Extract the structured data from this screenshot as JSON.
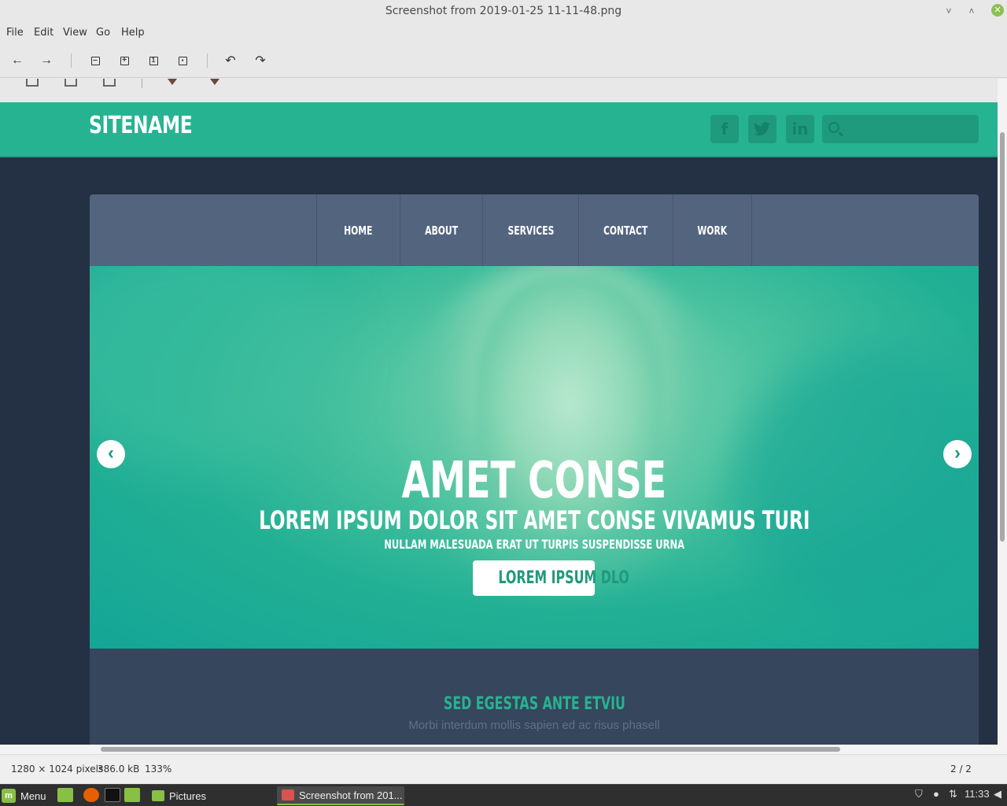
{
  "window": {
    "title": "Screenshot from 2019-01-25 11-11-48.png",
    "minimize_glyph": "˅",
    "restore_glyph": "˄",
    "close_glyph": "✕"
  },
  "menubar": [
    "File",
    "Edit",
    "View",
    "Go",
    "Help"
  ],
  "toolbar": {
    "back": "←",
    "forward": "→",
    "rotate_left": "↶",
    "rotate_right": "↷",
    "icons": [
      "back-arrow-icon",
      "forward-arrow-icon",
      "zoom-out-icon",
      "zoom-in-icon",
      "normal-size-icon",
      "best-fit-icon",
      "rotate-left-icon",
      "rotate-right-icon"
    ]
  },
  "website": {
    "sitename": "SITENAME",
    "social": {
      "facebook": "f",
      "twitter": "t",
      "linkedin": "in"
    },
    "nav": [
      "HOME",
      "ABOUT",
      "SERVICES",
      "CONTACT",
      "WORK"
    ],
    "hero": {
      "title": "AMET CONSE",
      "subtitle": "LOREM IPSUM DOLOR SIT AMET CONSE VIVAMUS TURI",
      "tagline": "NULLAM MALESUADA ERAT UT TURPIS SUSPENDISSE URNA",
      "button": "LOREM IPSUM DLO",
      "prev_glyph": "‹",
      "next_glyph": "›"
    },
    "section": {
      "title": "SED EGESTAS ANTE ETVIU",
      "subtitle": "Morbi interdum mollis sapien ed ac risus phasell"
    },
    "colors": {
      "accent": "#26b391",
      "navbar": "#53647e",
      "background": "#243044"
    }
  },
  "status": {
    "dimensions": "1280 × 1024 pixels",
    "size": "386.0 kB",
    "zoom": "133%",
    "position": "2 / 2"
  },
  "taskbar": {
    "menu_label": "Menu",
    "windows": [
      {
        "label": "Pictures",
        "icon": "folder-icon"
      },
      {
        "label": "Screenshot from 201...",
        "icon": "image-viewer-icon"
      }
    ],
    "clock": "11:33"
  }
}
